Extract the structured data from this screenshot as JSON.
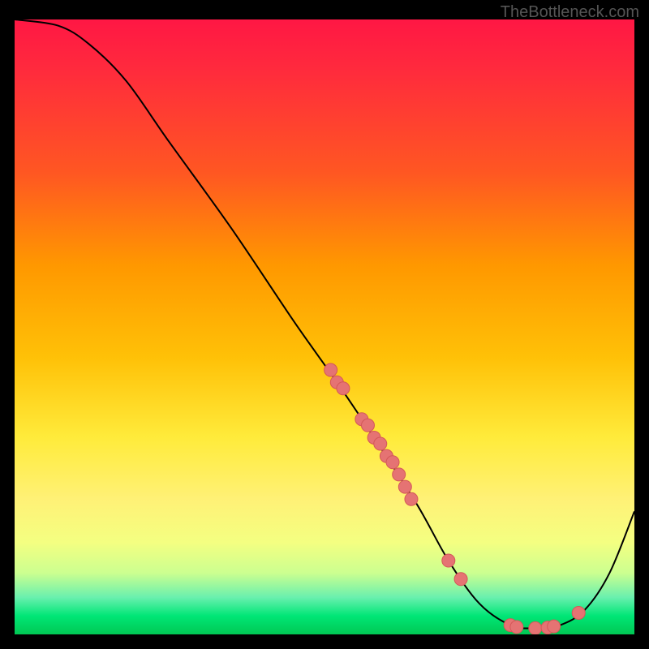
{
  "watermark": "TheBottleneck.com",
  "chart_data": {
    "type": "line",
    "title": "",
    "xlabel": "",
    "ylabel": "",
    "xlim": [
      0,
      100
    ],
    "ylim": [
      0,
      100
    ],
    "curve": [
      {
        "x": 0,
        "y": 100
      },
      {
        "x": 7,
        "y": 99
      },
      {
        "x": 12,
        "y": 96
      },
      {
        "x": 18,
        "y": 90
      },
      {
        "x": 25,
        "y": 80
      },
      {
        "x": 35,
        "y": 66
      },
      {
        "x": 45,
        "y": 51
      },
      {
        "x": 52,
        "y": 41
      },
      {
        "x": 58,
        "y": 32
      },
      {
        "x": 65,
        "y": 21
      },
      {
        "x": 70,
        "y": 12
      },
      {
        "x": 75,
        "y": 5
      },
      {
        "x": 80,
        "y": 1.5
      },
      {
        "x": 84,
        "y": 1
      },
      {
        "x": 88,
        "y": 1.5
      },
      {
        "x": 92,
        "y": 4
      },
      {
        "x": 96,
        "y": 10
      },
      {
        "x": 100,
        "y": 20
      }
    ],
    "markers": [
      {
        "x": 51,
        "y": 43
      },
      {
        "x": 52,
        "y": 41
      },
      {
        "x": 53,
        "y": 40
      },
      {
        "x": 56,
        "y": 35
      },
      {
        "x": 57,
        "y": 34
      },
      {
        "x": 58,
        "y": 32
      },
      {
        "x": 59,
        "y": 31
      },
      {
        "x": 60,
        "y": 29
      },
      {
        "x": 61,
        "y": 28
      },
      {
        "x": 62,
        "y": 26
      },
      {
        "x": 63,
        "y": 24
      },
      {
        "x": 64,
        "y": 22
      },
      {
        "x": 70,
        "y": 12
      },
      {
        "x": 72,
        "y": 9
      },
      {
        "x": 80,
        "y": 1.5
      },
      {
        "x": 81,
        "y": 1.2
      },
      {
        "x": 84,
        "y": 1
      },
      {
        "x": 86,
        "y": 1.1
      },
      {
        "x": 87,
        "y": 1.3
      },
      {
        "x": 91,
        "y": 3.5
      }
    ],
    "gradient_note": "Background is a vertical rainbow gradient from red (top, high bottleneck) to green (bottom, low bottleneck)."
  }
}
